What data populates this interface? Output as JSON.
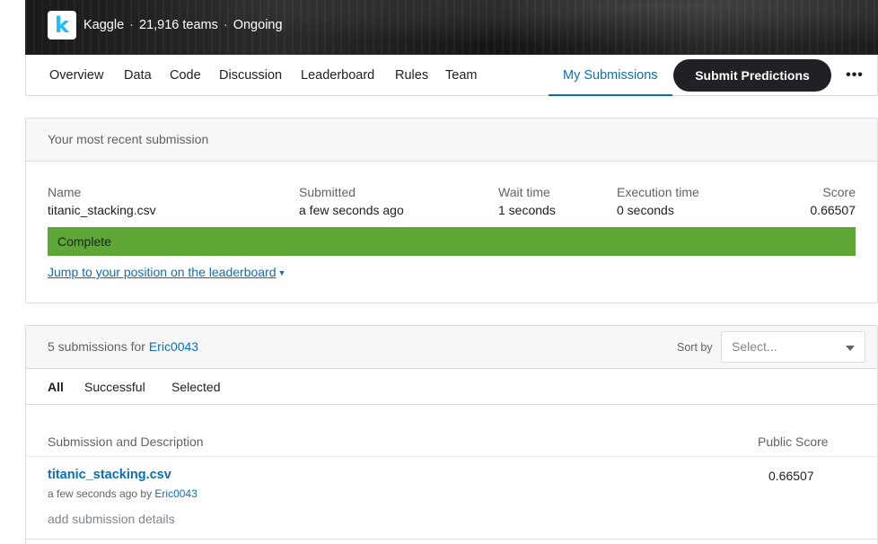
{
  "header": {
    "logo_letter": "k",
    "brand": "Kaggle",
    "teams": "21,916 teams",
    "status": "Ongoing"
  },
  "nav": {
    "items": [
      "Overview",
      "Data",
      "Code",
      "Discussion",
      "Leaderboard",
      "Rules",
      "Team"
    ],
    "active": "My Submissions",
    "submit_label": "Submit Predictions",
    "more_label": "•••"
  },
  "recent": {
    "heading": "Your most recent submission",
    "columns": [
      {
        "label": "Name",
        "value": "titanic_stacking.csv"
      },
      {
        "label": "Submitted",
        "value": "a few seconds ago"
      },
      {
        "label": "Wait time",
        "value": "1 seconds"
      },
      {
        "label": "Execution time",
        "value": "0 seconds"
      },
      {
        "label": "Score",
        "value": "0.66507"
      }
    ],
    "status": "Complete",
    "jump_link": "Jump to your position on the leaderboard"
  },
  "submissions": {
    "count_prefix": "5 submissions for",
    "user": "Eric0043",
    "sort_label": "Sort by",
    "sort_placeholder": "Select...",
    "filters": [
      "All",
      "Successful",
      "Selected"
    ],
    "table_headers": [
      "Submission and Description",
      "Public Score"
    ],
    "rows": [
      {
        "file": "titanic_stacking.csv",
        "time": "a few seconds ago by",
        "by": "Eric0043",
        "details": "add submission details",
        "score": "0.66507"
      }
    ]
  },
  "colors": {
    "accent": "#0a6fb5",
    "complete": "#5ea635",
    "dark_button": "#202124"
  }
}
